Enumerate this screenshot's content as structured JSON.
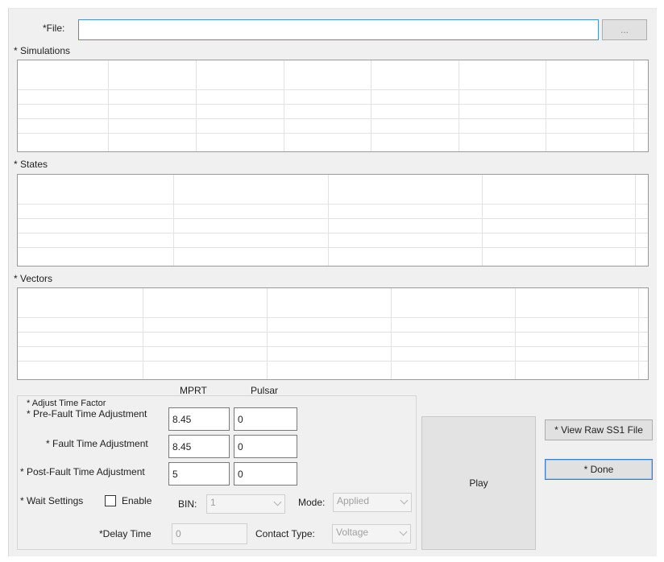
{
  "file": {
    "label": "*File:",
    "value": "",
    "browse_label": "..."
  },
  "simulations": {
    "label": "* Simulations"
  },
  "states": {
    "label": "* States"
  },
  "vectors": {
    "label": "* Vectors"
  },
  "time": {
    "mprt_header": "MPRT",
    "pulsar_header": "Pulsar",
    "adjust_label": "* Adjust Time Factor",
    "prefault_label": "* Pre-Fault Time Adjustment",
    "prefault_mprt": "8.45",
    "prefault_pulsar": "0",
    "fault_label": "* Fault Time Adjustment",
    "fault_mprt": "8.45",
    "fault_pulsar": "0",
    "postfault_label": "* Post-Fault Time Adjustment",
    "postfault_mprt": "5",
    "postfault_pulsar": "0"
  },
  "wait": {
    "label": "* Wait Settings",
    "enable_label": "Enable",
    "enabled": false,
    "bin_label": "BIN:",
    "bin_value": "1",
    "mode_label": "Mode:",
    "mode_value": "Applied",
    "delay_label": "*Delay  Time",
    "delay_value": "0",
    "contact_label": "Contact Type:",
    "contact_value": "Voltage"
  },
  "buttons": {
    "play": "Play",
    "view_raw": "* View Raw SS1 File",
    "done": "* Done"
  }
}
